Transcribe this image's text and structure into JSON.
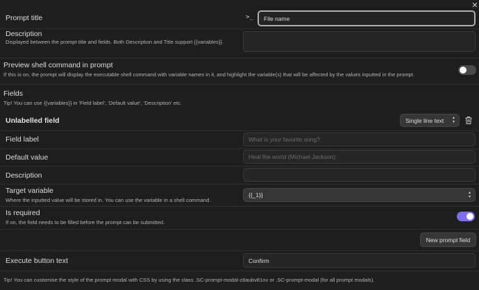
{
  "close_glyph": "✕",
  "prompt_title": {
    "label": "Prompt title",
    "terminal_glyph": ">_",
    "value": "File name"
  },
  "description": {
    "label": "Description",
    "help": "Displayed between the prompt title and fields. Both Description and Title support {{variables}}.",
    "value": ""
  },
  "preview_shell": {
    "label": "Preview shell command in prompt",
    "help": "If this is on, the prompt will display the executable shell command with variable names in it, and highlight the variable(s) that will be affected by the values inputted in the prompt.",
    "enabled": false
  },
  "fields_section": {
    "heading": "Fields",
    "tip": "Tip! You can use {{variables}} in 'Field label', 'Default value', 'Description' etc."
  },
  "field": {
    "heading": "Unlabelled field",
    "type_selected": "Single line text",
    "label_label": "Field label",
    "label_placeholder": "What is your favorite song?",
    "default_label": "Default value",
    "default_placeholder": "Heal the world (Michael Jackson)",
    "description_label": "Description",
    "description_value": "",
    "target_label": "Target variable",
    "target_help": "Where the inputted value will be stored in. You can use the variable in a shell command.",
    "target_value": "{{_1}}",
    "required_label": "Is required",
    "required_help": "If on, the field needs to be filled before the prompt can be submitted.",
    "required_enabled": true
  },
  "new_field_button": "New prompt field",
  "execute_button": {
    "label": "Execute button text",
    "value": "Confirm"
  },
  "footer_tip": "Tip! You can customise the style of the prompt modal with CSS by using the class .SC-prompt-modal-z8aubv81ov or .SC-prompt-modal (for all prompt modals).",
  "colors": {
    "background": "#1e1e1e",
    "accent_toggle_on": "#7f6df2",
    "toggle_off": "#4a4a4a"
  }
}
